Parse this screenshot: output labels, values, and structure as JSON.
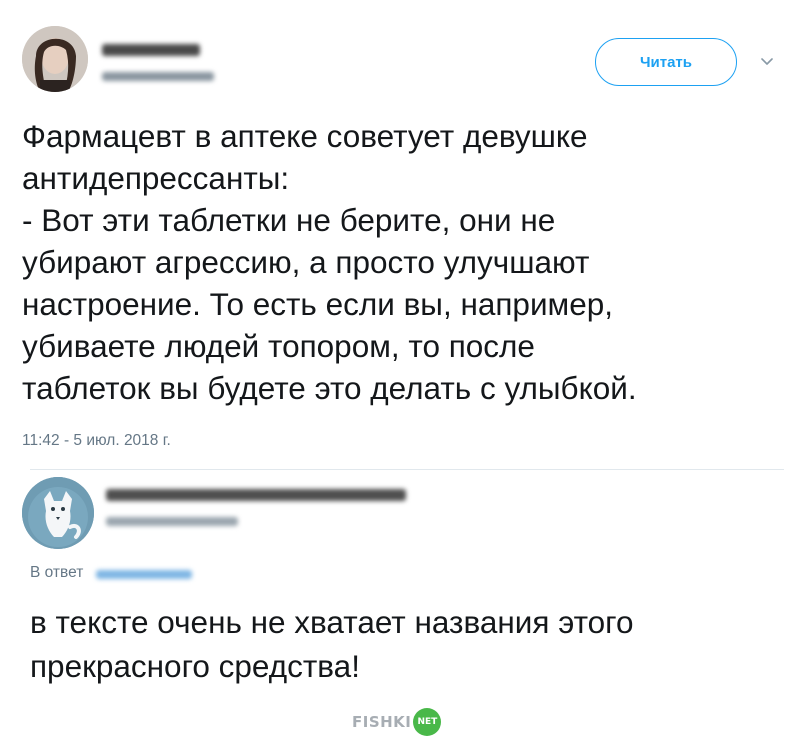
{
  "tweet": {
    "follow_label": "Читать",
    "lines": [
      "Фармацевт в аптеке советует девушке",
      "антидепрессанты:",
      "- Вот эти таблетки не берите, они не",
      "убирают агрессию, а просто улучшают",
      "настроение. То есть если вы, например,",
      "убиваете людей топором, то после",
      "таблеток вы будете это делать с улыбкой."
    ],
    "timestamp": "11:42 - 5 июл. 2018 г."
  },
  "reply": {
    "reply_to_label": "В ответ",
    "lines": [
      "в тексте очень не хватает названия этого",
      "прекрасного средства!"
    ]
  },
  "watermark": {
    "text": "FISHKI",
    "badge": "NET"
  },
  "icons": {
    "chevron": "chevron-down-icon",
    "avatar1": "avatar",
    "avatar2": "avatar"
  },
  "colors": {
    "accent": "#1da1f2",
    "text": "#14171a",
    "muted": "#657786",
    "watermark_green": "#49b849"
  }
}
